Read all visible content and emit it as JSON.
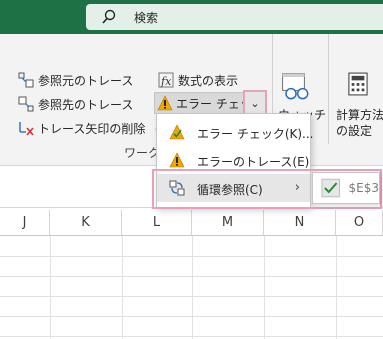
{
  "search": {
    "label": "検索"
  },
  "ribbon": {
    "trace_precedents": "参照元のトレース",
    "trace_dependents": "参照先のトレース",
    "remove_arrows": "トレース矢印の削除",
    "show_formulas": "数式の表示",
    "error_checking": "エラー チェック",
    "watch_window": "ウォッチ",
    "calc_options_line1": "計算方法",
    "calc_options_line2": "の設定",
    "group_label": "ワーク"
  },
  "menu": {
    "items": [
      {
        "label": "エラー チェック(K)...",
        "icon": "error-check-icon"
      },
      {
        "label": "エラーのトレース(E)",
        "icon": "warning-icon"
      },
      {
        "label": "循環参照(C)",
        "icon": "circular-reference-icon"
      }
    ],
    "submenu_value": "$E$3"
  },
  "columns": [
    "J",
    "K",
    "L",
    "M",
    "N",
    "O"
  ],
  "colors": {
    "title_bar": "#1e7145",
    "highlight_frame": "#e8a0c0",
    "warning": "#f0a800"
  }
}
